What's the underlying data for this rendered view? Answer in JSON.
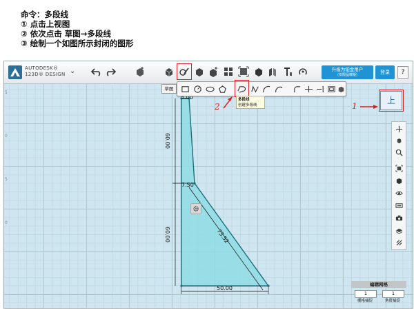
{
  "instructions": {
    "title": "命令：多段线",
    "steps": [
      "①  点击上视图",
      "②  依次点击  草图→多段线",
      "③  绘制一个如图所示封闭的图形"
    ]
  },
  "app": {
    "brand_line1": "AUTODESK®",
    "brand_line2": "123D® DESIGN",
    "upgrade_line1": "升级为铂金用户",
    "upgrade_line2": "(仅限品牌版)",
    "login_label": "登录",
    "help_label": "?"
  },
  "sketch": {
    "label": "草图",
    "tooltip_title": "多段线",
    "tooltip_desc": "创建多段线"
  },
  "viewcube": {
    "face": "上"
  },
  "annotations": {
    "marker1": "1",
    "marker2": "2"
  },
  "dimensions": {
    "top_width": "5.00",
    "upper_height": "60.00",
    "mid_width": "7.50",
    "lower_height": "60.00",
    "diagonal": "73.52",
    "bottom_width": "50.00"
  },
  "ruler_numbers": [
    "5",
    "0",
    "5",
    "0"
  ],
  "grid_panel": {
    "title": "编辑网格",
    "snap_value": "1",
    "angle_value": "1",
    "snap_label": "栅格捕捉",
    "angle_label": "角度捕捉"
  },
  "colors": {
    "accent": "#1f93d3",
    "highlight": "#e02020",
    "shape_fill": "#8fdce4",
    "shape_stroke": "#1a6f78"
  }
}
